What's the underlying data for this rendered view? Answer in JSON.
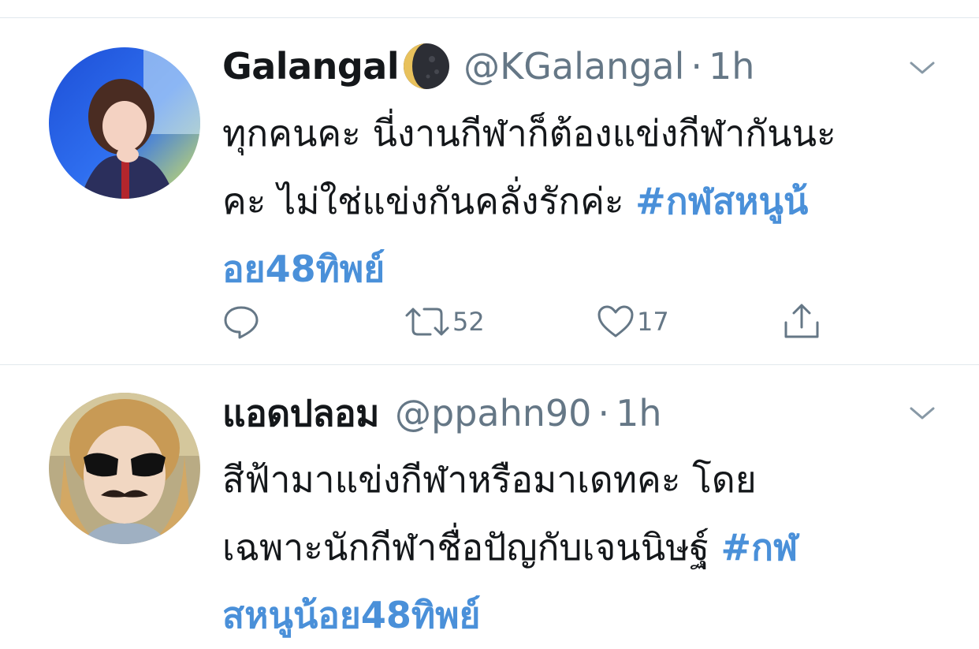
{
  "tweets": [
    {
      "display_name": "Galangal",
      "name_icon": "moon-icon",
      "handle": "@KGalangal",
      "separator": "·",
      "time": "1h",
      "text_lines": [
        "ทุกคนคะ นี่งานกีฬาก็ต้องแข่งกีฬากันนะ",
        "คะ ไม่ใช่แข่งกันคลั่งรักค่ะ "
      ],
      "hashtag_parts": [
        "#กฬสหนูน้",
        "อย48ทิพย์"
      ],
      "actions": {
        "reply_icon": "reply-icon",
        "retweet_icon": "retweet-icon",
        "retweet_count": "52",
        "like_icon": "heart-icon",
        "like_count": "17",
        "share_icon": "share-icon"
      },
      "menu_icon": "chevron-down-icon"
    },
    {
      "display_name": "แอดปลอม",
      "handle": "@ppahn90",
      "separator": "·",
      "time": "1h",
      "text_lines": [
        "สีฟ้ามาแข่งกีฬาหรือมาเดทคะ โดย",
        "เฉพาะนักกีฬาชื่อปัญกับเจนนิษฐ์ "
      ],
      "hashtag_parts": [
        "#กฬ",
        "สหนูน้อย48ทิพย์"
      ],
      "menu_icon": "chevron-down-icon"
    }
  ],
  "colors": {
    "text": "#14171a",
    "secondary": "#657786",
    "hashtag": "#4a90d9",
    "divider": "#e1e8ed"
  }
}
